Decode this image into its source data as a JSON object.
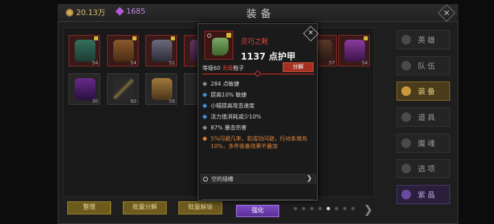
{
  "header": {
    "title": "装备",
    "gold": "20.13万",
    "gems": "1685"
  },
  "inventory": {
    "slots_row1": [
      {
        "count": "54",
        "locked": true
      },
      {
        "count": "54",
        "locked": true
      },
      {
        "count": "51",
        "locked": true
      },
      {
        "count": "",
        "locked": false
      },
      {
        "count": "57",
        "locked": false
      },
      {
        "count": "54",
        "locked": true
      }
    ],
    "slots_row2": [
      {
        "count": "30"
      },
      {
        "count": "60"
      },
      {
        "count": "59"
      }
    ]
  },
  "footer": {
    "sort_label": "整理",
    "batch_decompose_label": "批量分解",
    "batch_unlock_label": "批量解锁"
  },
  "sidebar": {
    "items": [
      {
        "label": "英雄",
        "icon": "hero-icon"
      },
      {
        "label": "队伍",
        "icon": "team-icon"
      },
      {
        "label": "装备",
        "icon": "equipment-icon"
      },
      {
        "label": "道具",
        "icon": "items-icon"
      },
      {
        "label": "魔魂",
        "icon": "soul-icon"
      },
      {
        "label": "选项",
        "icon": "settings-icon"
      },
      {
        "label": "紫晶",
        "icon": "amethyst-icon"
      }
    ],
    "active_index": 2
  },
  "tooltip": {
    "name": "灵巧之靴",
    "armor": "1137 点护甲",
    "level_prefix": "等级60",
    "level_tag": "无级",
    "level_suffix": "鞋子",
    "decompose_label": "分解",
    "stats": [
      {
        "text": "284 点敏捷",
        "color": "#8a8a8a"
      },
      {
        "text": "提高10% 敏捷",
        "color": "#3f8fd8"
      },
      {
        "text": "小幅提高攻击速度",
        "color": "#3f8fd8"
      },
      {
        "text": "法力值消耗减少10%",
        "color": "#3f8fd8"
      },
      {
        "text": "87% 暴击伤害",
        "color": "#8a8a8a"
      }
    ],
    "special": "5%闪避几率，若成功闪避，行动条填充10%，多件装备效果不叠加",
    "socket_label": "空的插槽",
    "enhance_label": "强化"
  },
  "colors": {
    "accent_gold": "#e8cf8a",
    "item_red": "#e0443a",
    "enhance_purple": "#7e4ac4"
  }
}
